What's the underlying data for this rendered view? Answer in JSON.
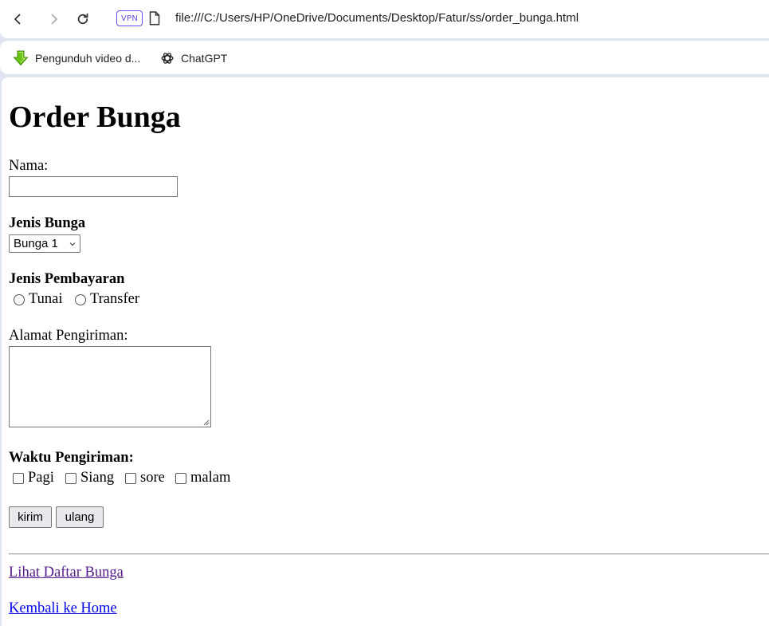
{
  "browser": {
    "url": "file:///C:/Users/HP/OneDrive/Documents/Desktop/Fatur/ss/order_bunga.html",
    "vpn_label": "VPN",
    "bookmarks": [
      {
        "label": "Pengunduh video d...",
        "icon": "download-arrow-icon"
      },
      {
        "label": "ChatGPT",
        "icon": "chatgpt-icon"
      }
    ]
  },
  "form": {
    "title": "Order Bunga",
    "nama_label": "Nama:",
    "nama_value": "",
    "jenis_bunga_label": "Jenis Bunga",
    "jenis_bunga_selected": "Bunga 1",
    "jenis_pembayaran_label": "Jenis Pembayaran",
    "payment_options": [
      "Tunai",
      "Transfer"
    ],
    "alamat_label": "Alamat Pengiriman:",
    "alamat_value": "",
    "waktu_label": "Waktu Pengiriman:",
    "waktu_options": [
      "Pagi",
      "Siang",
      "sore",
      "malam"
    ],
    "submit_label": "kirim",
    "reset_label": "ulang"
  },
  "links": {
    "daftar": "Lihat Daftar Bunga",
    "home": "Kembali ke Home"
  },
  "colors": {
    "link_visited": "#551a8b",
    "link_unvisited": "#0000ee",
    "vpn_accent": "#6c4df0"
  }
}
